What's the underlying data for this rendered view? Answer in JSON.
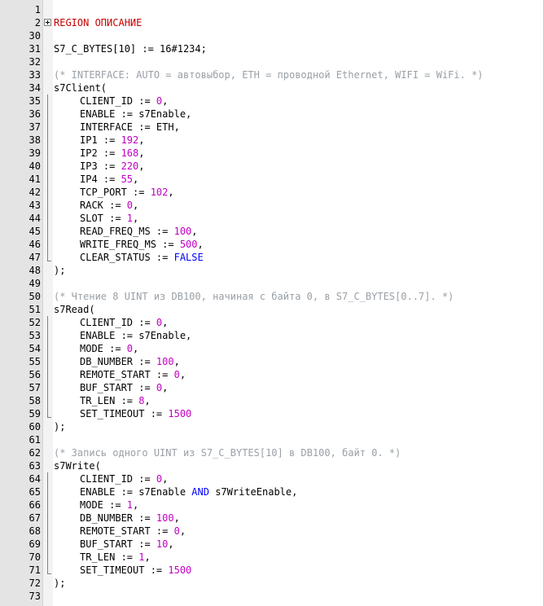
{
  "colors": {
    "region": "#c80000",
    "comment": "#9aa0a6",
    "number": "#c000c0",
    "keyword": "#0000ff",
    "text": "#000000",
    "gutter": "#e4e4e4"
  },
  "icons": {
    "fold_marker": "plus-box-icon"
  },
  "lines": [
    {
      "n": "1",
      "indent": false,
      "tokens": []
    },
    {
      "n": "2",
      "indent": false,
      "fold": "collapsed",
      "tokens": [
        {
          "t": "REGION ОПИСАНИЕ",
          "c": "region"
        }
      ]
    },
    {
      "n": "30",
      "indent": false,
      "tokens": []
    },
    {
      "n": "31",
      "indent": false,
      "tokens": [
        {
          "t": "S7_C_BYTES[10] := 16#1234;",
          "c": "plain"
        }
      ]
    },
    {
      "n": "32",
      "indent": false,
      "tokens": []
    },
    {
      "n": "33",
      "indent": false,
      "tokens": [
        {
          "t": "(* INTERFACE: AUTO = автовыбор, ETH = проводной Ethernet, WIFI = WiFi. *)",
          "c": "comment"
        }
      ]
    },
    {
      "n": "34",
      "indent": false,
      "tokens": [
        {
          "t": "s7Client(",
          "c": "plain"
        }
      ]
    },
    {
      "n": "35",
      "indent": true,
      "tokens": [
        {
          "t": "CLIENT_ID := ",
          "c": "plain"
        },
        {
          "t": "0",
          "c": "num"
        },
        {
          "t": ",",
          "c": "plain"
        }
      ]
    },
    {
      "n": "36",
      "indent": true,
      "tokens": [
        {
          "t": "ENABLE := s7Enable,",
          "c": "plain"
        }
      ]
    },
    {
      "n": "37",
      "indent": true,
      "tokens": [
        {
          "t": "INTERFACE := ETH,",
          "c": "plain"
        }
      ]
    },
    {
      "n": "38",
      "indent": true,
      "tokens": [
        {
          "t": "IP1 := ",
          "c": "plain"
        },
        {
          "t": "192",
          "c": "num"
        },
        {
          "t": ",",
          "c": "plain"
        }
      ]
    },
    {
      "n": "39",
      "indent": true,
      "tokens": [
        {
          "t": "IP2 := ",
          "c": "plain"
        },
        {
          "t": "168",
          "c": "num"
        },
        {
          "t": ",",
          "c": "plain"
        }
      ]
    },
    {
      "n": "40",
      "indent": true,
      "tokens": [
        {
          "t": "IP3 := ",
          "c": "plain"
        },
        {
          "t": "220",
          "c": "num"
        },
        {
          "t": ",",
          "c": "plain"
        }
      ]
    },
    {
      "n": "41",
      "indent": true,
      "tokens": [
        {
          "t": "IP4 := ",
          "c": "plain"
        },
        {
          "t": "55",
          "c": "num"
        },
        {
          "t": ",",
          "c": "plain"
        }
      ]
    },
    {
      "n": "42",
      "indent": true,
      "tokens": [
        {
          "t": "TCP_PORT := ",
          "c": "plain"
        },
        {
          "t": "102",
          "c": "num"
        },
        {
          "t": ",",
          "c": "plain"
        }
      ]
    },
    {
      "n": "43",
      "indent": true,
      "tokens": [
        {
          "t": "RACK := ",
          "c": "plain"
        },
        {
          "t": "0",
          "c": "num"
        },
        {
          "t": ",",
          "c": "plain"
        }
      ]
    },
    {
      "n": "44",
      "indent": true,
      "tokens": [
        {
          "t": "SLOT := ",
          "c": "plain"
        },
        {
          "t": "1",
          "c": "num"
        },
        {
          "t": ",",
          "c": "plain"
        }
      ]
    },
    {
      "n": "45",
      "indent": true,
      "tokens": [
        {
          "t": "READ_FREQ_MS := ",
          "c": "plain"
        },
        {
          "t": "100",
          "c": "num"
        },
        {
          "t": ",",
          "c": "plain"
        }
      ]
    },
    {
      "n": "46",
      "indent": true,
      "tokens": [
        {
          "t": "WRITE_FREQ_MS := ",
          "c": "plain"
        },
        {
          "t": "500",
          "c": "num"
        },
        {
          "t": ",",
          "c": "plain"
        }
      ]
    },
    {
      "n": "47",
      "indent": true,
      "tokens": [
        {
          "t": "CLEAR_STATUS := ",
          "c": "plain"
        },
        {
          "t": "FALSE",
          "c": "kw"
        }
      ]
    },
    {
      "n": "48",
      "indent": false,
      "tokens": [
        {
          "t": ");",
          "c": "plain"
        }
      ]
    },
    {
      "n": "49",
      "indent": false,
      "tokens": []
    },
    {
      "n": "50",
      "indent": false,
      "tokens": [
        {
          "t": "(* Чтение 8 UINT из DB100, начиная с байта 0, в S7_C_BYTES[0..7]. *)",
          "c": "comment"
        }
      ]
    },
    {
      "n": "51",
      "indent": false,
      "tokens": [
        {
          "t": "s7Read(",
          "c": "plain"
        }
      ]
    },
    {
      "n": "52",
      "indent": true,
      "tokens": [
        {
          "t": "CLIENT_ID := ",
          "c": "plain"
        },
        {
          "t": "0",
          "c": "num"
        },
        {
          "t": ",",
          "c": "plain"
        }
      ]
    },
    {
      "n": "53",
      "indent": true,
      "tokens": [
        {
          "t": "ENABLE := s7Enable,",
          "c": "plain"
        }
      ]
    },
    {
      "n": "54",
      "indent": true,
      "tokens": [
        {
          "t": "MODE := ",
          "c": "plain"
        },
        {
          "t": "0",
          "c": "num"
        },
        {
          "t": ",",
          "c": "plain"
        }
      ]
    },
    {
      "n": "55",
      "indent": true,
      "tokens": [
        {
          "t": "DB_NUMBER := ",
          "c": "plain"
        },
        {
          "t": "100",
          "c": "num"
        },
        {
          "t": ",",
          "c": "plain"
        }
      ]
    },
    {
      "n": "56",
      "indent": true,
      "tokens": [
        {
          "t": "REMOTE_START := ",
          "c": "plain"
        },
        {
          "t": "0",
          "c": "num"
        },
        {
          "t": ",",
          "c": "plain"
        }
      ]
    },
    {
      "n": "57",
      "indent": true,
      "tokens": [
        {
          "t": "BUF_START := ",
          "c": "plain"
        },
        {
          "t": "0",
          "c": "num"
        },
        {
          "t": ",",
          "c": "plain"
        }
      ]
    },
    {
      "n": "58",
      "indent": true,
      "tokens": [
        {
          "t": "TR_LEN := ",
          "c": "plain"
        },
        {
          "t": "8",
          "c": "num"
        },
        {
          "t": ",",
          "c": "plain"
        }
      ]
    },
    {
      "n": "59",
      "indent": true,
      "tokens": [
        {
          "t": "SET_TIMEOUT := ",
          "c": "plain"
        },
        {
          "t": "1500",
          "c": "num"
        }
      ]
    },
    {
      "n": "60",
      "indent": false,
      "tokens": [
        {
          "t": ");",
          "c": "plain"
        }
      ]
    },
    {
      "n": "61",
      "indent": false,
      "tokens": []
    },
    {
      "n": "62",
      "indent": false,
      "tokens": [
        {
          "t": "(* Запись одного UINT из S7_C_BYTES[10] в DB100, байт 0. *)",
          "c": "comment"
        }
      ]
    },
    {
      "n": "63",
      "indent": false,
      "tokens": [
        {
          "t": "s7Write(",
          "c": "plain"
        }
      ]
    },
    {
      "n": "64",
      "indent": true,
      "tokens": [
        {
          "t": "CLIENT_ID := ",
          "c": "plain"
        },
        {
          "t": "0",
          "c": "num"
        },
        {
          "t": ",",
          "c": "plain"
        }
      ]
    },
    {
      "n": "65",
      "indent": true,
      "tokens": [
        {
          "t": "ENABLE := s7Enable ",
          "c": "plain"
        },
        {
          "t": "AND",
          "c": "kw"
        },
        {
          "t": " s7WriteEnable,",
          "c": "plain"
        }
      ]
    },
    {
      "n": "66",
      "indent": true,
      "tokens": [
        {
          "t": "MODE := ",
          "c": "plain"
        },
        {
          "t": "1",
          "c": "num"
        },
        {
          "t": ",",
          "c": "plain"
        }
      ]
    },
    {
      "n": "67",
      "indent": true,
      "tokens": [
        {
          "t": "DB_NUMBER := ",
          "c": "plain"
        },
        {
          "t": "100",
          "c": "num"
        },
        {
          "t": ",",
          "c": "plain"
        }
      ]
    },
    {
      "n": "68",
      "indent": true,
      "tokens": [
        {
          "t": "REMOTE_START := ",
          "c": "plain"
        },
        {
          "t": "0",
          "c": "num"
        },
        {
          "t": ",",
          "c": "plain"
        }
      ]
    },
    {
      "n": "69",
      "indent": true,
      "tokens": [
        {
          "t": "BUF_START := ",
          "c": "plain"
        },
        {
          "t": "10",
          "c": "num"
        },
        {
          "t": ",",
          "c": "plain"
        }
      ]
    },
    {
      "n": "70",
      "indent": true,
      "tokens": [
        {
          "t": "TR_LEN := ",
          "c": "plain"
        },
        {
          "t": "1",
          "c": "num"
        },
        {
          "t": ",",
          "c": "plain"
        }
      ]
    },
    {
      "n": "71",
      "indent": true,
      "tokens": [
        {
          "t": "SET_TIMEOUT := ",
          "c": "plain"
        },
        {
          "t": "1500",
          "c": "num"
        }
      ]
    },
    {
      "n": "72",
      "indent": false,
      "tokens": [
        {
          "t": ");",
          "c": "plain"
        }
      ]
    },
    {
      "n": "73",
      "indent": false,
      "tokens": []
    }
  ]
}
